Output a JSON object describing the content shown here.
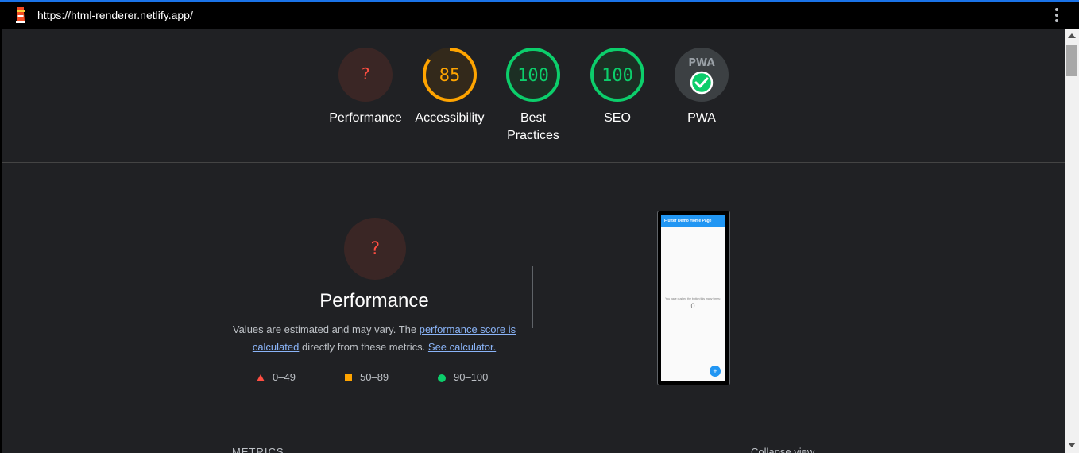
{
  "browser": {
    "url": "https://html-renderer.netlify.app/",
    "site_icon": "lighthouse-icon",
    "menu_icon": "kebab-menu-icon"
  },
  "gauges": [
    {
      "label": "Performance",
      "score": "?",
      "status": "error"
    },
    {
      "label": "Accessibility",
      "score": "85",
      "status": "average"
    },
    {
      "label": "Best Practices",
      "score": "100",
      "status": "pass"
    },
    {
      "label": "SEO",
      "score": "100",
      "status": "pass"
    },
    {
      "label": "PWA",
      "score": "",
      "status": "pwa",
      "badge": "PWA"
    }
  ],
  "colors": {
    "fail": "#ff4e42",
    "average": "#ffa400",
    "pass": "#0cce6b",
    "link": "#8ab4f8",
    "background": "#202124"
  },
  "performance": {
    "score": "?",
    "title": "Performance",
    "desc_prefix": "Values are estimated and may vary. The ",
    "link_score": "performance score is calculated",
    "desc_middle": " directly from these metrics. ",
    "link_calculator": "See calculator."
  },
  "legend": [
    {
      "shape": "triangle",
      "range": "0–49"
    },
    {
      "shape": "square",
      "range": "50–89"
    },
    {
      "shape": "circle",
      "range": "90–100"
    }
  ],
  "preview": {
    "app_title": "Flutter Demo Home Page",
    "body_text": "You have pushed the button this many times:",
    "counter": "0",
    "fab": "+"
  },
  "sections": {
    "metrics": "METRICS",
    "collapse": "Collapse view"
  }
}
